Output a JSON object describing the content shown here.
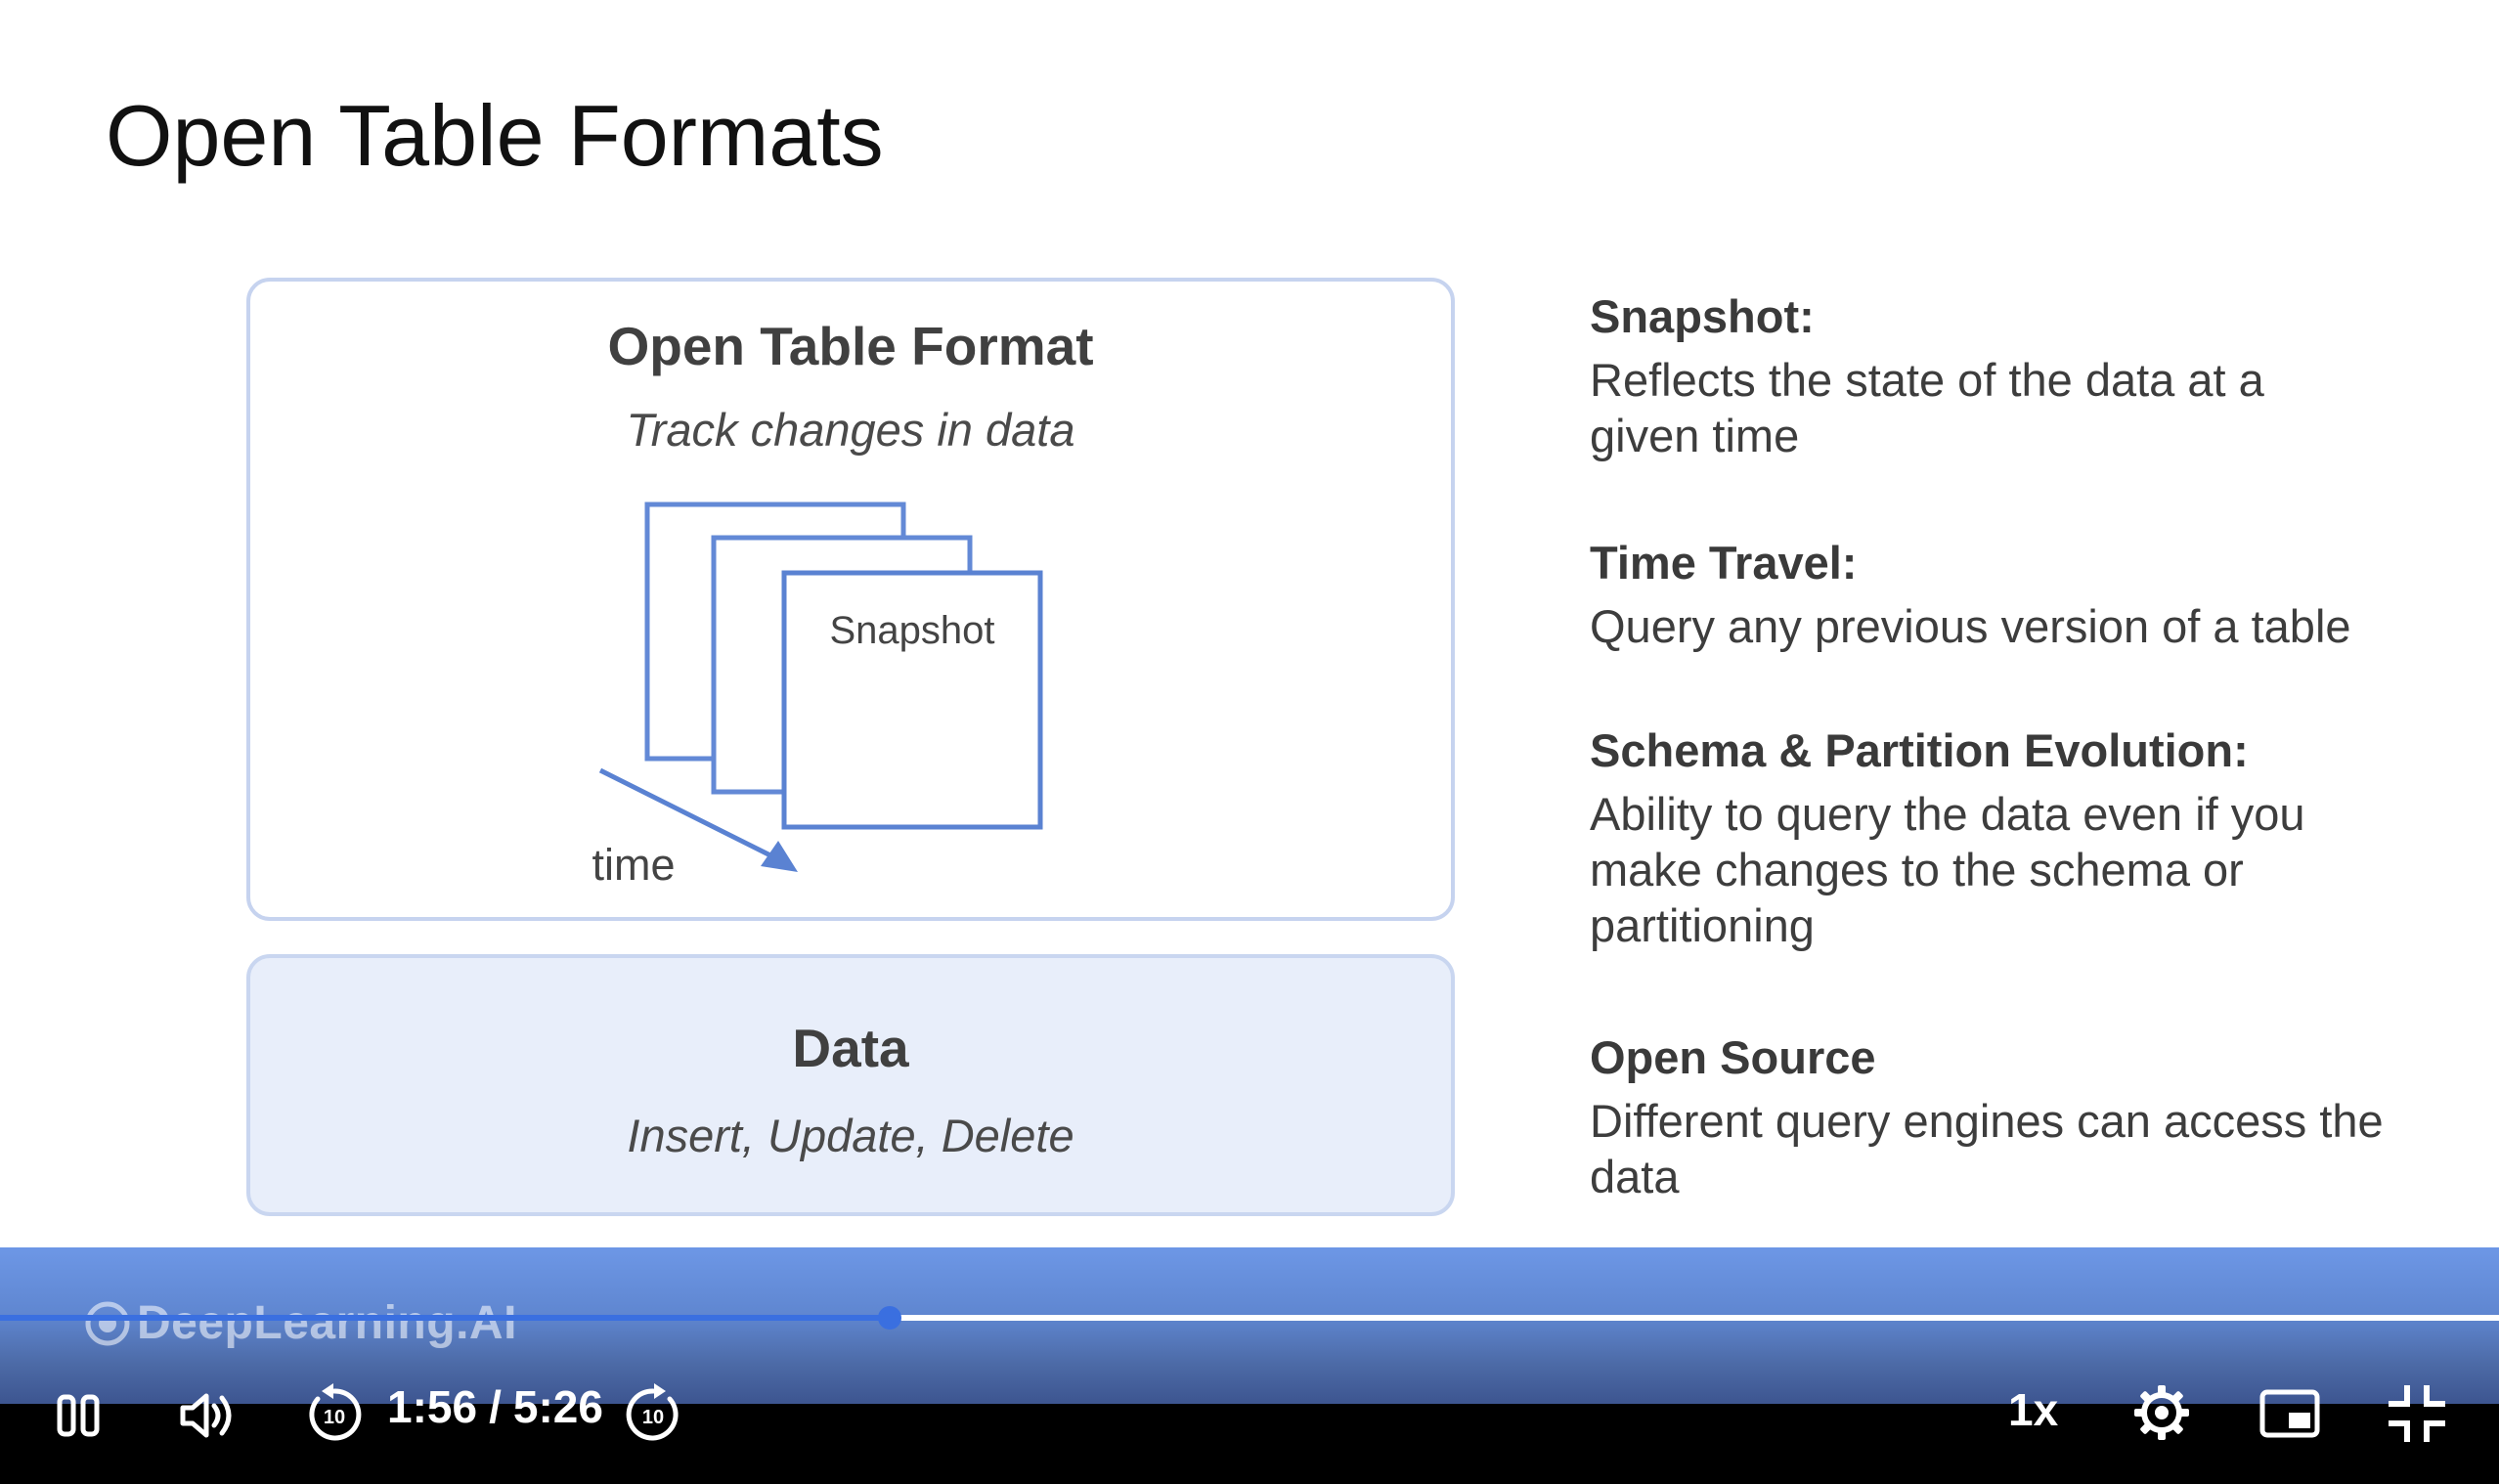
{
  "slide": {
    "title": "Open Table Formats",
    "otf_box": {
      "heading": "Open Table Format",
      "subtitle": "Track changes in data",
      "snapshot_label": "Snapshot",
      "time_label": "time"
    },
    "data_box": {
      "heading": "Data",
      "subtitle": "Insert, Update, Delete"
    },
    "features": [
      {
        "title": "Snapshot:",
        "description": "Reflects the state of the data at a given time"
      },
      {
        "title": "Time Travel:",
        "description": "Query any previous version of a table"
      },
      {
        "title": "Schema & Partition Evolution:",
        "description": "Ability to query the data even if you make changes to the schema or partitioning"
      },
      {
        "title": "Open Source",
        "description": "Different query engines can access the data"
      }
    ]
  },
  "player": {
    "watermark": "DeepLearning.AI",
    "current_time": "1:56",
    "separator": "/",
    "duration": "5:26",
    "progress_fraction": 0.356,
    "speed": "1x",
    "icons": {
      "play_pause": "pause-icon",
      "volume": "volume-icon",
      "rewind": "rewind-10-icon",
      "forward": "forward-10-icon",
      "settings": "gear-icon",
      "pip": "picture-in-picture-icon",
      "fullscreen": "exit-fullscreen-icon"
    },
    "colors": {
      "accent": "#3a6fe0",
      "overlay": "#6d97e6"
    }
  }
}
